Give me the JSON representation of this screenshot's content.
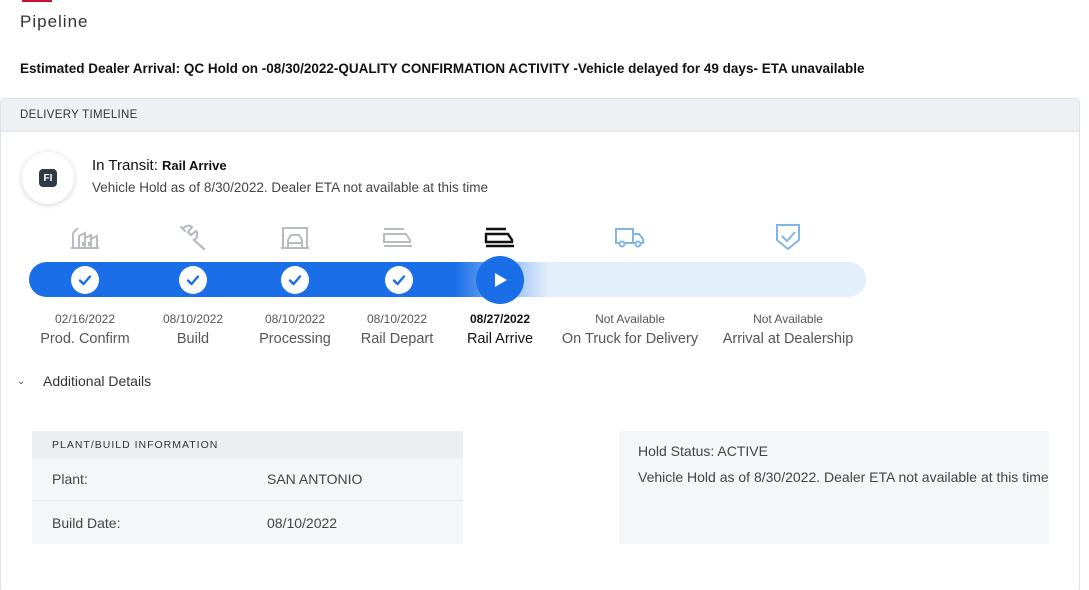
{
  "page": {
    "title": "Pipeline",
    "eta_line": "Estimated Dealer Arrival: QC Hold on -08/30/2022-QUALITY CONFIRMATION ACTIVITY -Vehicle delayed for 49 days- ETA unavailable"
  },
  "timeline": {
    "header": "DELIVERY TIMELINE",
    "status_badge": "FI",
    "status_label": "In Transit:",
    "status_sub": "Rail Arrive",
    "status_desc": "Vehicle Hold as of 8/30/2022. Dealer ETA not available at this time",
    "progress_fraction": 0.62,
    "stages": [
      {
        "name": "Prod. Confirm",
        "date": "02/16/2022",
        "icon": "factory-icon",
        "state": "complete"
      },
      {
        "name": "Build",
        "date": "08/10/2022",
        "icon": "wrench-icon",
        "state": "complete"
      },
      {
        "name": "Processing",
        "date": "08/10/2022",
        "icon": "processing-bay-icon",
        "state": "complete"
      },
      {
        "name": "Rail Depart",
        "date": "08/10/2022",
        "icon": "rail-car-icon",
        "state": "complete"
      },
      {
        "name": "Rail Arrive",
        "date": "08/27/2022",
        "icon": "rail-car-icon",
        "state": "current"
      },
      {
        "name": "On Truck for Delivery",
        "date": "Not Available",
        "icon": "truck-icon",
        "state": "pending"
      },
      {
        "name": "Arrival at Dealership",
        "date": "Not Available",
        "icon": "shield-check-icon",
        "state": "pending"
      }
    ]
  },
  "details": {
    "toggle_label": "Additional Details",
    "plant_header": "PLANT/BUILD INFORMATION",
    "plant_rows": [
      {
        "label": "Plant:",
        "value": "SAN ANTONIO"
      },
      {
        "label": "Build Date:",
        "value": "08/10/2022"
      }
    ],
    "hold_status": "Hold Status: ACTIVE",
    "hold_desc": "Vehicle Hold as of 8/30/2022. Dealer ETA not available at this time"
  },
  "colors": {
    "accent": "#1a6fe8",
    "track_bg": "#e4effc",
    "brand_red": "#c8102e",
    "pending_icon": "#7fb6e6"
  }
}
